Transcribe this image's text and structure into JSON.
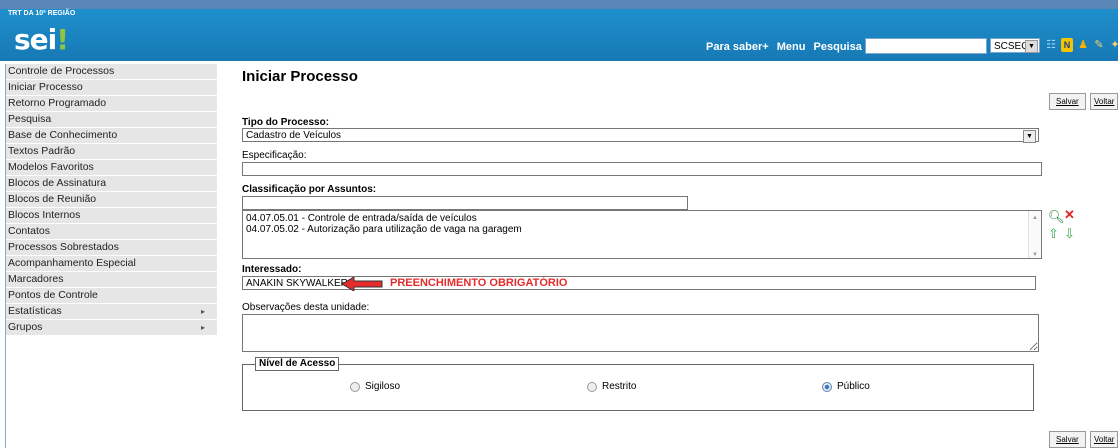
{
  "header": {
    "org_name": "TRT DA 10ª REGIÃO",
    "logo": "sei",
    "nav": [
      "Para saber+",
      "Menu",
      "Pesquisa"
    ],
    "search_value": "",
    "unit": "SCSEG",
    "icons": [
      "list-icon",
      "notes-icon",
      "user-icon",
      "tools-icon",
      "exit-icon"
    ]
  },
  "sidebar": {
    "items": [
      {
        "label": "Controle de Processos"
      },
      {
        "label": "Iniciar Processo"
      },
      {
        "label": "Retorno Programado"
      },
      {
        "label": "Pesquisa"
      },
      {
        "label": "Base de Conhecimento"
      },
      {
        "label": "Textos Padrão"
      },
      {
        "label": "Modelos Favoritos"
      },
      {
        "label": "Blocos de Assinatura"
      },
      {
        "label": "Blocos de Reunião"
      },
      {
        "label": "Blocos Internos"
      },
      {
        "label": "Contatos"
      },
      {
        "label": "Processos Sobrestados"
      },
      {
        "label": "Acompanhamento Especial"
      },
      {
        "label": "Marcadores"
      },
      {
        "label": "Pontos de Controle"
      },
      {
        "label": "Estatísticas",
        "submenu": "▸"
      },
      {
        "label": "Grupos",
        "submenu": "▸"
      }
    ]
  },
  "form": {
    "title": "Iniciar Processo",
    "save_label": "Salvar",
    "back_label": "Voltar",
    "tipo_label": "Tipo do Processo:",
    "tipo_value": "Cadastro de Veículos",
    "especificacao_label": "Especificação:",
    "especificacao_value": "",
    "classificacao_label": "Classificação por Assuntos:",
    "classificacao_search": "",
    "subjects": [
      "04.07.05.01 - Controle de entrada/saída de veículos",
      "04.07.05.02 - Autorização para utilização de vaga na garagem"
    ],
    "interessado_label": "Interessado:",
    "interessado_value": "ANAKIN SKYWALKER",
    "annotation": "PREENCHIMENTO OBRIGATÓRIO",
    "observacoes_label": "Observações desta unidade:",
    "observacoes_value": "",
    "nivel_acesso_label": "Nível de Acesso",
    "access_options": [
      "Sigiloso",
      "Restrito",
      "Público"
    ],
    "access_selected": "Público"
  },
  "colors": {
    "header_blue": "#1a84c3",
    "annotation_red": "#e52b2b",
    "sidebar_bg": "#e6e6e6"
  }
}
